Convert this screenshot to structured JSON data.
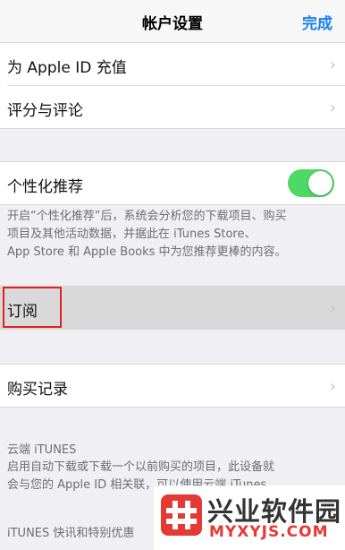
{
  "nav": {
    "title": "帐户设置",
    "done_label": "完成"
  },
  "group1": {
    "items": [
      {
        "label": "为 Apple ID 充值"
      },
      {
        "label": "评分与评论"
      }
    ]
  },
  "personalized": {
    "label": "个性化推荐",
    "enabled": true,
    "note_lines": [
      "开启“个性化推荐”后，系统会分析您的下载项目、购买",
      "项目及其他活动数据，并据此在 iTunes Store、",
      "App Store 和 Apple Books 中为您推荐更棒的内容。"
    ]
  },
  "subscriptions": {
    "label": "订阅"
  },
  "purchase_history": {
    "label": "购买记录"
  },
  "cloud": {
    "header": "云端 iTUNES",
    "note_lines": [
      "启用自动下载或下载一个以前购买的项目，此设备就",
      "会与您的 Apple ID 相关联，可以使用云端 iTunes"
    ]
  },
  "news_header": "iTUNES 快讯和特别优惠",
  "watermark": {
    "title": "兴业软件园",
    "url": "MYXYJS.COM"
  },
  "colors": {
    "accent": "#1a7ff0",
    "toggle_on": "#4cd964",
    "highlight": "#e0221f",
    "watermark_red": "#e53935"
  }
}
